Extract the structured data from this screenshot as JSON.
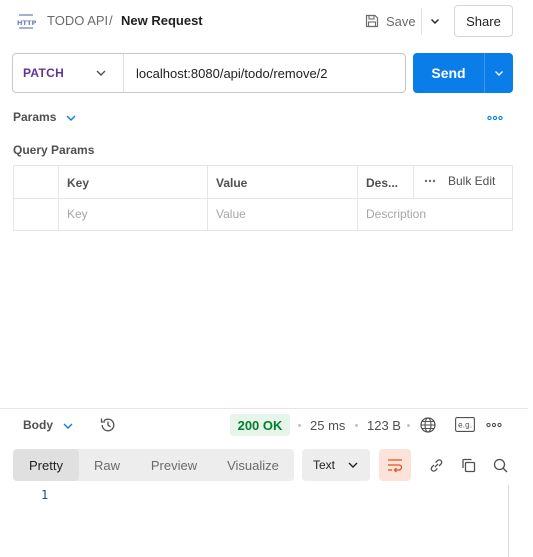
{
  "header": {
    "icon": "http-icon",
    "icon_text": "HTTP",
    "collection": "TODO API",
    "separator": "/",
    "request_name": "New Request",
    "save_label": "Save",
    "share_label": "Share"
  },
  "request": {
    "method": "PATCH",
    "url": "localhost:8080/api/todo/remove/2",
    "send_label": "Send",
    "method_color": "#623497",
    "send_color": "#0b7de8"
  },
  "params": {
    "section_label": "Params",
    "title": "Query Params",
    "columns": [
      "Key",
      "Value",
      "Des...",
      "Bulk Edit"
    ],
    "placeholders": {
      "key": "Key",
      "value": "Value",
      "description": "Description"
    }
  },
  "response": {
    "body_label": "Body",
    "status": "200 OK",
    "status_color": "#007f31",
    "time": "25 ms",
    "size": "123 B",
    "example_label": "e.g.",
    "tabs": [
      "Pretty",
      "Raw",
      "Preview",
      "Visualize"
    ],
    "active_tab": "Pretty",
    "format": "Text",
    "line_numbers": [
      "1"
    ]
  }
}
